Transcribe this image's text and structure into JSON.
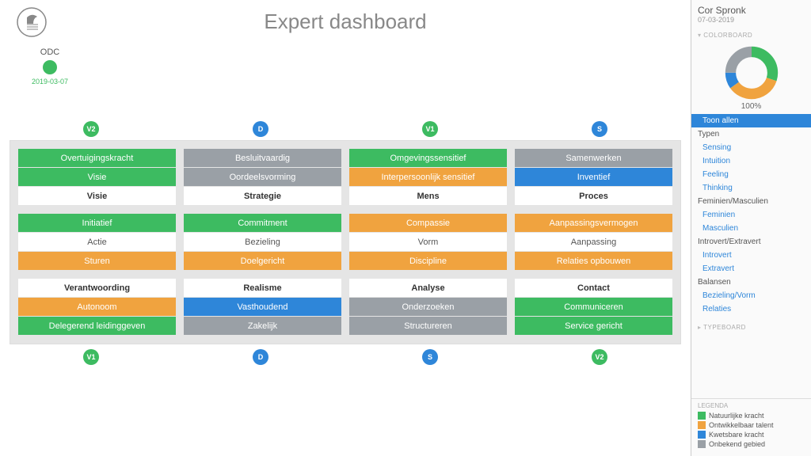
{
  "title": "Expert dashboard",
  "odc": {
    "label": "ODC",
    "date": "2019-03-07"
  },
  "badges_top": [
    "V2",
    "D",
    "V1",
    "S"
  ],
  "badges_bottom": [
    "V1",
    "D",
    "S",
    "V2"
  ],
  "badge_colors_top": [
    "green",
    "blue",
    "green",
    "blue"
  ],
  "badge_colors_bottom": [
    "green",
    "blue",
    "blue",
    "green"
  ],
  "grid": [
    [
      {
        "rows": [
          [
            "Overtuigingskracht",
            "green"
          ],
          [
            "Visie",
            "green"
          ],
          [
            "Visie",
            "white"
          ]
        ]
      },
      {
        "rows": [
          [
            "Besluitvaardig",
            "gray"
          ],
          [
            "Oordeelsvorming",
            "gray"
          ],
          [
            "Strategie",
            "white"
          ]
        ]
      },
      {
        "rows": [
          [
            "Omgevingssensitief",
            "green"
          ],
          [
            "Interpersoonlijk sensitief",
            "orange"
          ],
          [
            "Mens",
            "white"
          ]
        ]
      },
      {
        "rows": [
          [
            "Samenwerken",
            "gray"
          ],
          [
            "Inventief",
            "blue"
          ],
          [
            "Proces",
            "white"
          ]
        ]
      }
    ],
    [
      {
        "rows": [
          [
            "Initiatief",
            "green"
          ],
          [
            "Actie",
            "plain"
          ],
          [
            "Sturen",
            "orange"
          ]
        ]
      },
      {
        "rows": [
          [
            "Commitment",
            "green"
          ],
          [
            "Bezieling",
            "plain"
          ],
          [
            "Doelgericht",
            "orange"
          ]
        ],
        "mergeMid": "left"
      },
      {
        "rows": [
          [
            "Compassie",
            "orange"
          ],
          [
            "Vorm",
            "plain"
          ],
          [
            "Discipline",
            "orange"
          ]
        ],
        "mergeMid": "right"
      },
      {
        "rows": [
          [
            "Aanpassingsvermogen",
            "orange"
          ],
          [
            "Aanpassing",
            "plain"
          ],
          [
            "Relaties opbouwen",
            "orange"
          ]
        ]
      }
    ],
    [
      {
        "rows": [
          [
            "Verantwoording",
            "white"
          ],
          [
            "Autonoom",
            "orange"
          ],
          [
            "Delegerend leidinggeven",
            "green"
          ]
        ]
      },
      {
        "rows": [
          [
            "Realisme",
            "white"
          ],
          [
            "Vasthoudend",
            "blue"
          ],
          [
            "Zakelijk",
            "gray"
          ]
        ]
      },
      {
        "rows": [
          [
            "Analyse",
            "white"
          ],
          [
            "Onderzoeken",
            "gray"
          ],
          [
            "Structureren",
            "gray"
          ]
        ]
      },
      {
        "rows": [
          [
            "Contact",
            "white"
          ],
          [
            "Communiceren",
            "green"
          ],
          [
            "Service gericht",
            "green"
          ]
        ]
      }
    ]
  ],
  "side": {
    "name": "Cor Spronk",
    "date": "07-03-2019",
    "colorboard": "Colorboard",
    "chart_pct": "100%",
    "filters": {
      "toon_allen": "Toon allen",
      "groups": [
        {
          "header": "Typen",
          "items": [
            "Sensing",
            "Intuition",
            "Feeling",
            "Thinking"
          ]
        },
        {
          "header": "Feminien/Masculien",
          "items": [
            "Feminien",
            "Masculien"
          ]
        },
        {
          "header": "Introvert/Extravert",
          "items": [
            "Introvert",
            "Extravert"
          ]
        },
        {
          "header": "Balansen",
          "items": [
            "Bezieling/Vorm",
            "Relaties"
          ]
        }
      ]
    },
    "typeboard": "Typeboard",
    "legend_title": "Legenda",
    "legend": [
      [
        "green",
        "Natuurlijke kracht"
      ],
      [
        "orange",
        "Ontwikkelbaar talent"
      ],
      [
        "blue",
        "Kwetsbare kracht"
      ],
      [
        "gray",
        "Onbekend gebied"
      ]
    ]
  },
  "chart_data": {
    "type": "pie",
    "title": "Colorboard distribution",
    "series": [
      {
        "name": "Natuurlijke kracht",
        "value": 30,
        "color": "#3dbb61"
      },
      {
        "name": "Ontwikkelbaar talent",
        "value": 35,
        "color": "#f0a33f"
      },
      {
        "name": "Kwetsbare kracht",
        "value": 10,
        "color": "#2e86d9"
      },
      {
        "name": "Onbekend gebied",
        "value": 25,
        "color": "#9aa0a6"
      }
    ],
    "total_label": "100%"
  }
}
